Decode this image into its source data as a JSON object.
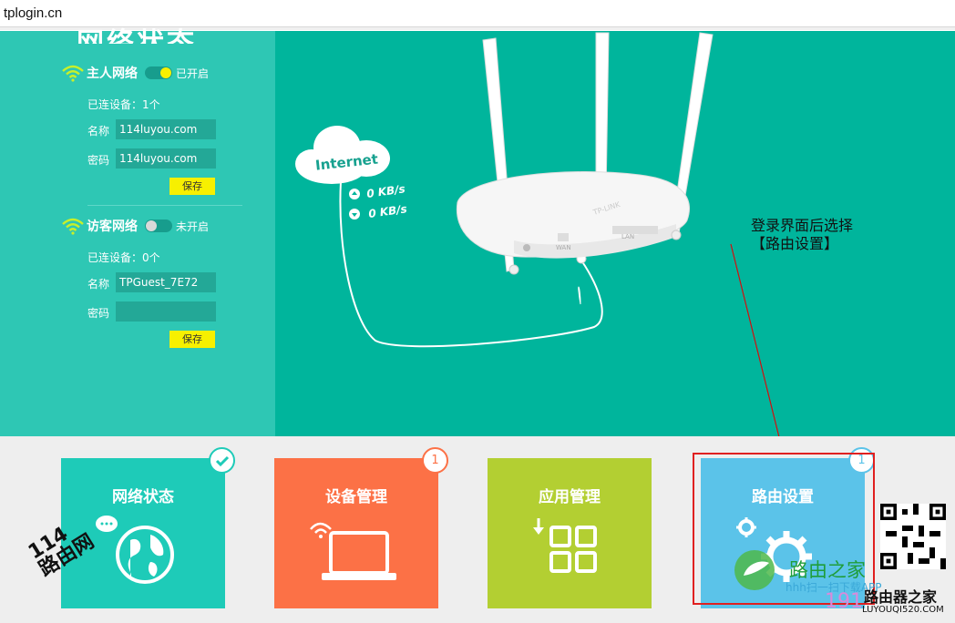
{
  "address_bar": {
    "url": "tplogin.cn"
  },
  "sidebar": {
    "partial_title": "网络状态",
    "host_network": {
      "title": "主人网络",
      "toggle_state": "已开启",
      "connected_devices": "已连设备：1个",
      "name_label": "名称",
      "name_value": "114luyou.com",
      "password_label": "密码",
      "password_value": "114luyou.com",
      "save_label": "保存"
    },
    "guest_network": {
      "title": "访客网络",
      "toggle_state": "未开启",
      "connected_devices": "已连设备：0个",
      "name_label": "名称",
      "name_value": "TPGuest_7E72",
      "password_label": "密码",
      "password_value": "",
      "save_label": "保存"
    }
  },
  "illustration": {
    "cloud_label": "Internet",
    "upload_speed": "0 KB/s",
    "download_speed": "0 KB/s",
    "router_brand": "TP-LINK",
    "port_wan": "WAN",
    "port_lan": "LAN"
  },
  "annotation": {
    "line1": "登录界面后选择",
    "line2": "【路由设置】"
  },
  "tiles": [
    {
      "label": "网络状态",
      "color": "#1ecbb8",
      "badge": "",
      "badge_type": "check"
    },
    {
      "label": "设备管理",
      "color": "#fc7146",
      "badge": "1",
      "badge_type": "count"
    },
    {
      "label": "应用管理",
      "color": "#b3cf32",
      "badge": "",
      "badge_type": "none"
    },
    {
      "label": "路由设置",
      "color": "#5bc3e9",
      "badge": "1",
      "badge_type": "count"
    }
  ],
  "watermarks": {
    "left_num": "114",
    "left_text": "路由网",
    "right_name": "路由之家",
    "right_scan": "hhh扫一扫下载APP",
    "right_num": "191",
    "right_logo": "路由器之家",
    "right_domain": "LUYOUQI520.COM"
  },
  "colors": {
    "sidebar": "#2ec7b4",
    "main": "#00b59c",
    "toggle_on": "#f7f000",
    "save_button": "#f7f000",
    "highlight_box": "#e02020"
  }
}
